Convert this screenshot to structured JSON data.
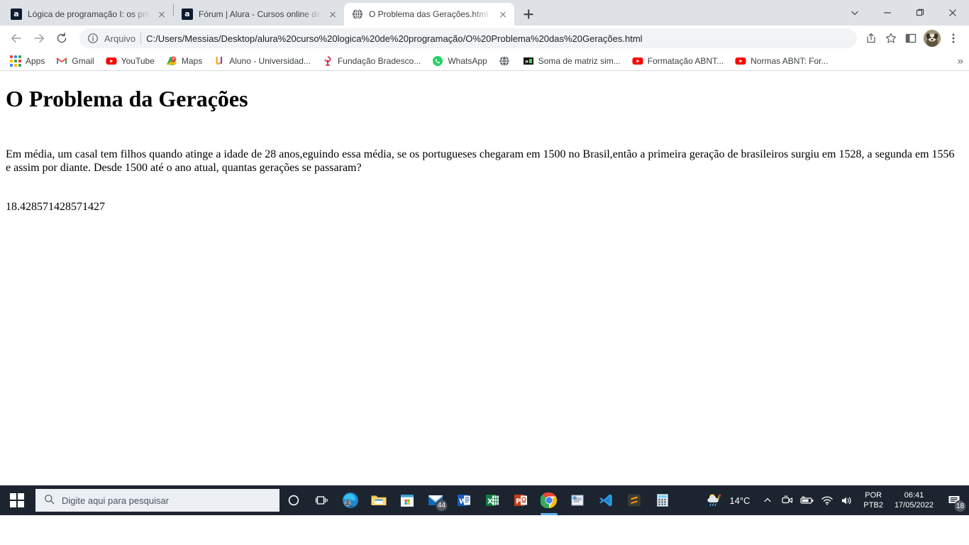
{
  "browser": {
    "tabs": [
      {
        "title": "Lógica de programação I: os prin",
        "favicon": "alura-icon",
        "active": false
      },
      {
        "title": "Fórum | Alura - Cursos online de",
        "favicon": "alura-icon",
        "active": false
      },
      {
        "title": "O Problema das Gerações.html",
        "favicon": "globe-icon",
        "active": true
      }
    ],
    "new_tab_label": "+",
    "window_controls": [
      "tab-search-icon",
      "minimize-icon",
      "maximize-icon",
      "close-icon"
    ],
    "nav": {
      "back": "back-arrow-icon",
      "forward": "forward-arrow-icon",
      "reload": "reload-icon"
    },
    "omnibox": {
      "scheme_label": "Arquivo",
      "url": "C:/Users/Messias/Desktop/alura%20curso%20logica%20de%20programação/O%20Problema%20das%20Gerações.html",
      "info_icon": "info-circle-icon"
    },
    "toolbar_icons": [
      "share-icon",
      "bookmark-star-icon",
      "side-panel-icon",
      "profile-avatar",
      "more-menu-icon"
    ],
    "bookmarks": [
      {
        "label": "Apps",
        "icon": "apps-grid-icon"
      },
      {
        "label": "Gmail",
        "icon": "gmail-icon"
      },
      {
        "label": "YouTube",
        "icon": "youtube-icon"
      },
      {
        "label": "Maps",
        "icon": "maps-pin-icon"
      },
      {
        "label": "Aluno - Universidad...",
        "icon": "unisuam-icon"
      },
      {
        "label": "Fundação Bradesco...",
        "icon": "bradesco-icon"
      },
      {
        "label": "WhatsApp",
        "icon": "whatsapp-icon"
      },
      {
        "label": "",
        "icon": "globe-icon"
      },
      {
        "label": "Soma de matriz sim...",
        "icon": "matrix-icon"
      },
      {
        "label": "Formatação ABNT...",
        "icon": "youtube-icon"
      },
      {
        "label": "Normas ABNT: For...",
        "icon": "youtube-icon"
      }
    ],
    "bookmarks_overflow": "»"
  },
  "page": {
    "heading": "O Problema da Gerações",
    "paragraph": "Em média, um casal tem filhos quando atinge a idade de 28 anos,eguindo essa média, se os portugueses chegaram em 1500 no Brasil,então a primeira geração de brasileiros surgiu em 1528, a segunda em 1556 e assim por diante. Desde 1500 até o ano atual, quantas gerações se passaram?",
    "result": "18.428571428571427"
  },
  "taskbar": {
    "start_icon": "windows-logo-icon",
    "search": {
      "placeholder": "Digite aqui para pesquisar",
      "icon": "search-icon"
    },
    "items": [
      {
        "name": "cortana-icon",
        "badge": ""
      },
      {
        "name": "task-view-icon",
        "badge": ""
      },
      {
        "name": "edge-icon",
        "badge": ""
      },
      {
        "name": "file-explorer-icon",
        "badge": ""
      },
      {
        "name": "microsoft-store-icon",
        "badge": ""
      },
      {
        "name": "mail-icon",
        "badge": "44"
      },
      {
        "name": "word-icon",
        "badge": ""
      },
      {
        "name": "excel-icon",
        "badge": ""
      },
      {
        "name": "powerpoint-icon",
        "badge": ""
      },
      {
        "name": "chrome-icon",
        "badge": ""
      },
      {
        "name": "wordpad-icon",
        "badge": ""
      },
      {
        "name": "vscode-icon",
        "badge": ""
      },
      {
        "name": "sublime-text-icon",
        "badge": ""
      },
      {
        "name": "calculator-icon",
        "badge": ""
      }
    ],
    "weather": {
      "temperature": "14°C",
      "icon": "sun-cloud-rain-icon"
    },
    "tray_icons": [
      "show-hidden-icons-chevron",
      "meet-now-icon",
      "battery-icon",
      "wifi-icon",
      "volume-icon"
    ],
    "language": {
      "line1": "POR",
      "line2": "PTB2"
    },
    "clock": {
      "time": "06:41",
      "date": "17/05/2022"
    },
    "notifications": {
      "icon": "notification-icon",
      "count": "18"
    }
  },
  "colors": {
    "tabstrip": "#dee1e6",
    "toolbar": "#ffffff",
    "omnibox": "#f1f3f4",
    "taskbar": "#1c2430",
    "accent": "#1a73e8"
  }
}
